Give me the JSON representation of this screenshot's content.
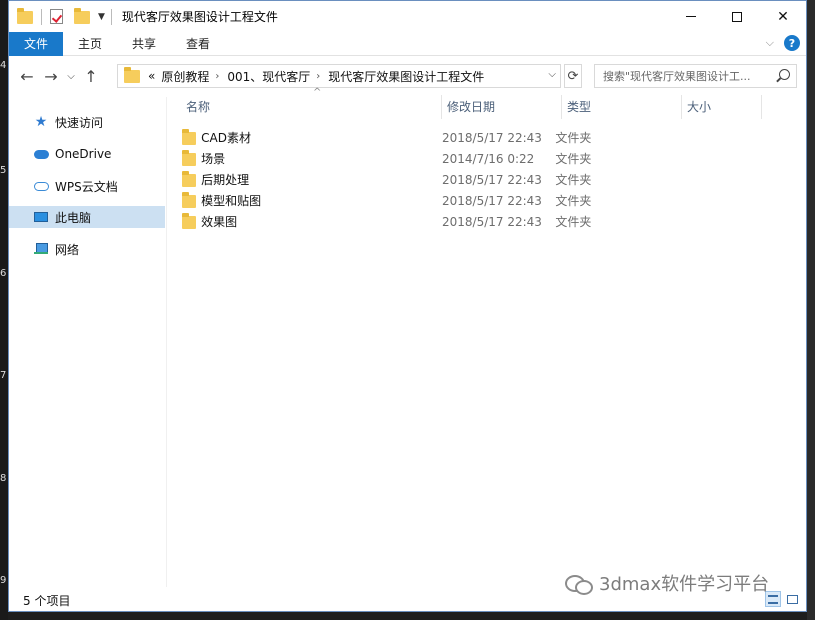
{
  "window": {
    "title": "现代客厅效果图设计工程文件"
  },
  "ribbon": {
    "tabs": [
      {
        "label": "文件",
        "active": true
      },
      {
        "label": "主页",
        "active": false
      },
      {
        "label": "共享",
        "active": false
      },
      {
        "label": "查看",
        "active": false
      }
    ],
    "help_label": "?"
  },
  "address": {
    "overflow": "«",
    "crumbs": [
      "原创教程",
      "001、现代客厅",
      "现代客厅效果图设计工程文件"
    ]
  },
  "search": {
    "placeholder": "搜索\"现代客厅效果图设计工..."
  },
  "sidebar": {
    "items": [
      {
        "label": "快速访问",
        "icon": "star-icon"
      },
      {
        "label": "OneDrive",
        "icon": "onedrive-icon"
      },
      {
        "label": "WPS云文档",
        "icon": "cloud-icon"
      },
      {
        "label": "此电脑",
        "icon": "computer-icon",
        "selected": true
      },
      {
        "label": "网络",
        "icon": "network-icon"
      }
    ]
  },
  "columns": {
    "name": "名称",
    "date": "修改日期",
    "type": "类型",
    "size": "大小"
  },
  "files": [
    {
      "name": "CAD素材",
      "date": "2018/5/17 22:43",
      "type": "文件夹"
    },
    {
      "name": "场景",
      "date": "2014/7/16 0:22",
      "type": "文件夹"
    },
    {
      "name": "后期处理",
      "date": "2018/5/17 22:43",
      "type": "文件夹"
    },
    {
      "name": "模型和贴图",
      "date": "2018/5/17 22:43",
      "type": "文件夹"
    },
    {
      "name": "效果图",
      "date": "2018/5/17 22:43",
      "type": "文件夹"
    }
  ],
  "status": {
    "count": "5 个项目"
  },
  "desktop_edge": [
    "4",
    "5",
    "6",
    "7",
    "8",
    "9"
  ],
  "watermark": "3dmax软件学习平台",
  "colors": {
    "accent": "#1979ca",
    "selected": "#cce0f2",
    "folder": "#f6cd5c"
  }
}
